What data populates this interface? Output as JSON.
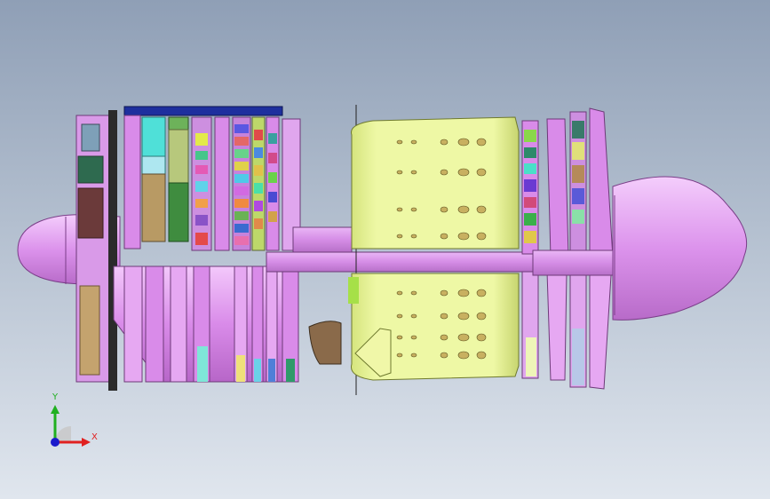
{
  "viewport": {
    "background_top": "#8f9fb6",
    "background_bottom": "#e0e6ee"
  },
  "triad": {
    "x_label": "X",
    "y_label": "Y",
    "x_color": "#e02020",
    "y_color": "#20b020",
    "z_color": "#1a1acc"
  },
  "model": {
    "part_colors": {
      "casing": "#e09ef0",
      "combustor": "#eaf59b",
      "duct": "#8a6a4a",
      "flange": "#1e2f9e"
    }
  }
}
